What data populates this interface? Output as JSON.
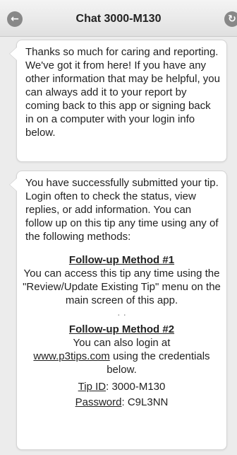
{
  "header": {
    "title": "Chat 3000-M130",
    "back_icon": "back-arrow-icon",
    "refresh_icon": "refresh-icon"
  },
  "messages": [
    {
      "text": "Thanks so much for caring and reporting. We've got it from here! If you have any other information that may be helpful, you can always add it to your report by coming back to this app or signing back in on a computer with your login info below."
    },
    {
      "intro": "You have successfully submitted your tip. Login often to check the status, view replies, or add information. You can follow up on this tip any time using any of the following methods:",
      "method1": {
        "heading": "Follow-up Method #1",
        "text": "You can access this tip any time using the \"Review/Update Existing Tip\" menu on the main screen of this app."
      },
      "separator": ". .",
      "method2": {
        "heading": "Follow-up Method #2",
        "text_before": "You can also login at",
        "link": "www.p3tips.com",
        "text_after": "using the credentials below."
      },
      "tip_id_label": "Tip ID",
      "tip_id_value": "3000-M130",
      "password_label": "Password",
      "password_value": "C9L3NN"
    }
  ]
}
